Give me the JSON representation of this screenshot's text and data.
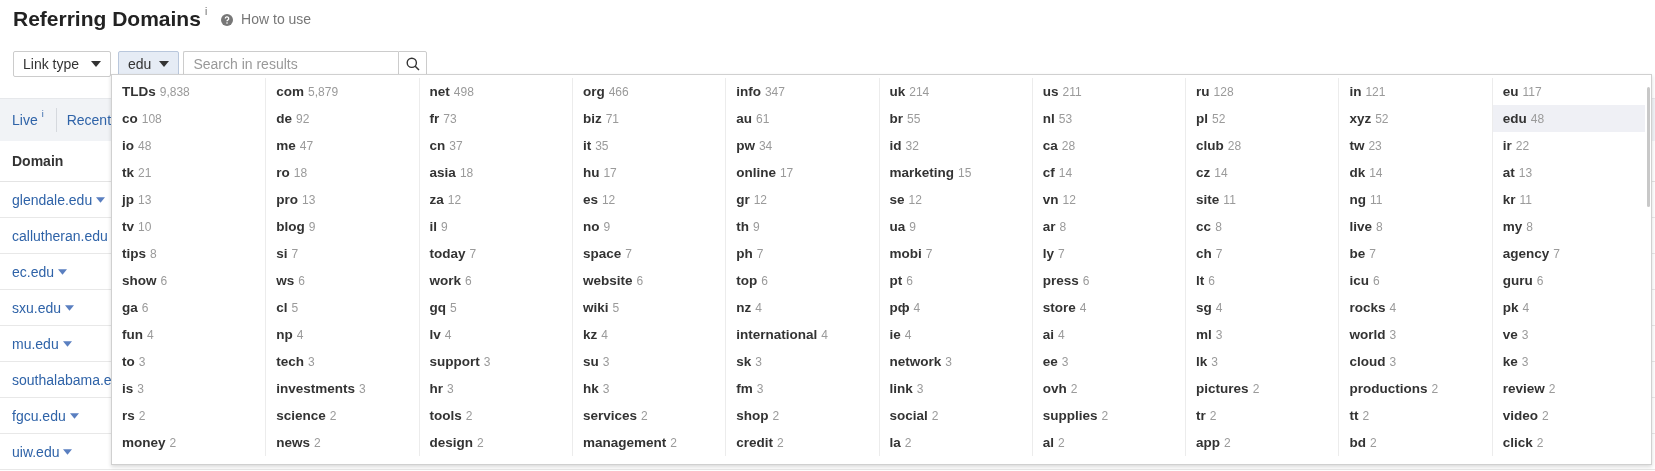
{
  "header": {
    "title": "Referring Domains",
    "title_info": "i",
    "help_link": "How to use"
  },
  "filters": {
    "link_type": "Link type",
    "tld": "edu",
    "search": {
      "placeholder": "Search in results"
    }
  },
  "tabs": [
    {
      "label": "Live",
      "info": "i"
    },
    {
      "label": "Recent"
    }
  ],
  "table": {
    "columns": [
      "Domain"
    ],
    "rows": [
      {
        "domain": "glendale.edu"
      },
      {
        "domain": "callutheran.edu"
      },
      {
        "domain": "ec.edu"
      },
      {
        "domain": "sxu.edu"
      },
      {
        "domain": "mu.edu"
      },
      {
        "domain": "southalabama.e"
      },
      {
        "domain": "fgcu.edu"
      },
      {
        "domain": "uiw.edu"
      }
    ]
  },
  "tld_menu": {
    "items": [
      {
        "name": "TLDs",
        "count": "9,838",
        "selected": false
      },
      {
        "name": "com",
        "count": "5,879",
        "selected": false
      },
      {
        "name": "net",
        "count": "498",
        "selected": false
      },
      {
        "name": "org",
        "count": "466",
        "selected": false
      },
      {
        "name": "info",
        "count": "347",
        "selected": false
      },
      {
        "name": "uk",
        "count": "214",
        "selected": false
      },
      {
        "name": "us",
        "count": "211",
        "selected": false
      },
      {
        "name": "ru",
        "count": "128",
        "selected": false
      },
      {
        "name": "in",
        "count": "121",
        "selected": false
      },
      {
        "name": "eu",
        "count": "117",
        "selected": false
      },
      {
        "name": "co",
        "count": "108",
        "selected": false
      },
      {
        "name": "de",
        "count": "92",
        "selected": false
      },
      {
        "name": "fr",
        "count": "73",
        "selected": false
      },
      {
        "name": "biz",
        "count": "71",
        "selected": false
      },
      {
        "name": "au",
        "count": "61",
        "selected": false
      },
      {
        "name": "br",
        "count": "55",
        "selected": false
      },
      {
        "name": "nl",
        "count": "53",
        "selected": false
      },
      {
        "name": "pl",
        "count": "52",
        "selected": false
      },
      {
        "name": "xyz",
        "count": "52",
        "selected": false
      },
      {
        "name": "edu",
        "count": "48",
        "selected": true
      },
      {
        "name": "io",
        "count": "48",
        "selected": false
      },
      {
        "name": "me",
        "count": "47",
        "selected": false
      },
      {
        "name": "cn",
        "count": "37",
        "selected": false
      },
      {
        "name": "it",
        "count": "35",
        "selected": false
      },
      {
        "name": "pw",
        "count": "34",
        "selected": false
      },
      {
        "name": "id",
        "count": "32",
        "selected": false
      },
      {
        "name": "ca",
        "count": "28",
        "selected": false
      },
      {
        "name": "club",
        "count": "28",
        "selected": false
      },
      {
        "name": "tw",
        "count": "23",
        "selected": false
      },
      {
        "name": "ir",
        "count": "22",
        "selected": false
      },
      {
        "name": "tk",
        "count": "21",
        "selected": false
      },
      {
        "name": "ro",
        "count": "18",
        "selected": false
      },
      {
        "name": "asia",
        "count": "18",
        "selected": false
      },
      {
        "name": "hu",
        "count": "17",
        "selected": false
      },
      {
        "name": "online",
        "count": "17",
        "selected": false
      },
      {
        "name": "marketing",
        "count": "15",
        "selected": false
      },
      {
        "name": "cf",
        "count": "14",
        "selected": false
      },
      {
        "name": "cz",
        "count": "14",
        "selected": false
      },
      {
        "name": "dk",
        "count": "14",
        "selected": false
      },
      {
        "name": "at",
        "count": "13",
        "selected": false
      },
      {
        "name": "jp",
        "count": "13",
        "selected": false
      },
      {
        "name": "pro",
        "count": "13",
        "selected": false
      },
      {
        "name": "za",
        "count": "12",
        "selected": false
      },
      {
        "name": "es",
        "count": "12",
        "selected": false
      },
      {
        "name": "gr",
        "count": "12",
        "selected": false
      },
      {
        "name": "se",
        "count": "12",
        "selected": false
      },
      {
        "name": "vn",
        "count": "12",
        "selected": false
      },
      {
        "name": "site",
        "count": "11",
        "selected": false
      },
      {
        "name": "ng",
        "count": "11",
        "selected": false
      },
      {
        "name": "kr",
        "count": "11",
        "selected": false
      },
      {
        "name": "tv",
        "count": "10",
        "selected": false
      },
      {
        "name": "blog",
        "count": "9",
        "selected": false
      },
      {
        "name": "il",
        "count": "9",
        "selected": false
      },
      {
        "name": "no",
        "count": "9",
        "selected": false
      },
      {
        "name": "th",
        "count": "9",
        "selected": false
      },
      {
        "name": "ua",
        "count": "9",
        "selected": false
      },
      {
        "name": "ar",
        "count": "8",
        "selected": false
      },
      {
        "name": "cc",
        "count": "8",
        "selected": false
      },
      {
        "name": "live",
        "count": "8",
        "selected": false
      },
      {
        "name": "my",
        "count": "8",
        "selected": false
      },
      {
        "name": "tips",
        "count": "8",
        "selected": false
      },
      {
        "name": "si",
        "count": "7",
        "selected": false
      },
      {
        "name": "today",
        "count": "7",
        "selected": false
      },
      {
        "name": "space",
        "count": "7",
        "selected": false
      },
      {
        "name": "ph",
        "count": "7",
        "selected": false
      },
      {
        "name": "mobi",
        "count": "7",
        "selected": false
      },
      {
        "name": "ly",
        "count": "7",
        "selected": false
      },
      {
        "name": "ch",
        "count": "7",
        "selected": false
      },
      {
        "name": "be",
        "count": "7",
        "selected": false
      },
      {
        "name": "agency",
        "count": "7",
        "selected": false
      },
      {
        "name": "show",
        "count": "6",
        "selected": false
      },
      {
        "name": "ws",
        "count": "6",
        "selected": false
      },
      {
        "name": "work",
        "count": "6",
        "selected": false
      },
      {
        "name": "website",
        "count": "6",
        "selected": false
      },
      {
        "name": "top",
        "count": "6",
        "selected": false
      },
      {
        "name": "pt",
        "count": "6",
        "selected": false
      },
      {
        "name": "press",
        "count": "6",
        "selected": false
      },
      {
        "name": "lt",
        "count": "6",
        "selected": false
      },
      {
        "name": "icu",
        "count": "6",
        "selected": false
      },
      {
        "name": "guru",
        "count": "6",
        "selected": false
      },
      {
        "name": "ga",
        "count": "6",
        "selected": false
      },
      {
        "name": "cl",
        "count": "5",
        "selected": false
      },
      {
        "name": "gq",
        "count": "5",
        "selected": false
      },
      {
        "name": "wiki",
        "count": "5",
        "selected": false
      },
      {
        "name": "nz",
        "count": "4",
        "selected": false
      },
      {
        "name": "рф",
        "count": "4",
        "selected": false
      },
      {
        "name": "store",
        "count": "4",
        "selected": false
      },
      {
        "name": "sg",
        "count": "4",
        "selected": false
      },
      {
        "name": "rocks",
        "count": "4",
        "selected": false
      },
      {
        "name": "pk",
        "count": "4",
        "selected": false
      },
      {
        "name": "fun",
        "count": "4",
        "selected": false
      },
      {
        "name": "np",
        "count": "4",
        "selected": false
      },
      {
        "name": "lv",
        "count": "4",
        "selected": false
      },
      {
        "name": "kz",
        "count": "4",
        "selected": false
      },
      {
        "name": "international",
        "count": "4",
        "selected": false
      },
      {
        "name": "ie",
        "count": "4",
        "selected": false
      },
      {
        "name": "ai",
        "count": "4",
        "selected": false
      },
      {
        "name": "ml",
        "count": "3",
        "selected": false
      },
      {
        "name": "world",
        "count": "3",
        "selected": false
      },
      {
        "name": "ve",
        "count": "3",
        "selected": false
      },
      {
        "name": "to",
        "count": "3",
        "selected": false
      },
      {
        "name": "tech",
        "count": "3",
        "selected": false
      },
      {
        "name": "support",
        "count": "3",
        "selected": false
      },
      {
        "name": "su",
        "count": "3",
        "selected": false
      },
      {
        "name": "sk",
        "count": "3",
        "selected": false
      },
      {
        "name": "network",
        "count": "3",
        "selected": false
      },
      {
        "name": "ee",
        "count": "3",
        "selected": false
      },
      {
        "name": "lk",
        "count": "3",
        "selected": false
      },
      {
        "name": "cloud",
        "count": "3",
        "selected": false
      },
      {
        "name": "ke",
        "count": "3",
        "selected": false
      },
      {
        "name": "is",
        "count": "3",
        "selected": false
      },
      {
        "name": "investments",
        "count": "3",
        "selected": false
      },
      {
        "name": "hr",
        "count": "3",
        "selected": false
      },
      {
        "name": "hk",
        "count": "3",
        "selected": false
      },
      {
        "name": "fm",
        "count": "3",
        "selected": false
      },
      {
        "name": "link",
        "count": "3",
        "selected": false
      },
      {
        "name": "ovh",
        "count": "2",
        "selected": false
      },
      {
        "name": "pictures",
        "count": "2",
        "selected": false
      },
      {
        "name": "productions",
        "count": "2",
        "selected": false
      },
      {
        "name": "review",
        "count": "2",
        "selected": false
      },
      {
        "name": "rs",
        "count": "2",
        "selected": false
      },
      {
        "name": "science",
        "count": "2",
        "selected": false
      },
      {
        "name": "tools",
        "count": "2",
        "selected": false
      },
      {
        "name": "services",
        "count": "2",
        "selected": false
      },
      {
        "name": "shop",
        "count": "2",
        "selected": false
      },
      {
        "name": "social",
        "count": "2",
        "selected": false
      },
      {
        "name": "supplies",
        "count": "2",
        "selected": false
      },
      {
        "name": "tr",
        "count": "2",
        "selected": false
      },
      {
        "name": "tt",
        "count": "2",
        "selected": false
      },
      {
        "name": "video",
        "count": "2",
        "selected": false
      },
      {
        "name": "money",
        "count": "2",
        "selected": false
      },
      {
        "name": "news",
        "count": "2",
        "selected": false
      },
      {
        "name": "design",
        "count": "2",
        "selected": false
      },
      {
        "name": "management",
        "count": "2",
        "selected": false
      },
      {
        "name": "credit",
        "count": "2",
        "selected": false
      },
      {
        "name": "la",
        "count": "2",
        "selected": false
      },
      {
        "name": "al",
        "count": "2",
        "selected": false
      },
      {
        "name": "app",
        "count": "2",
        "selected": false
      },
      {
        "name": "bd",
        "count": "2",
        "selected": false
      },
      {
        "name": "click",
        "count": "2",
        "selected": false
      }
    ]
  }
}
